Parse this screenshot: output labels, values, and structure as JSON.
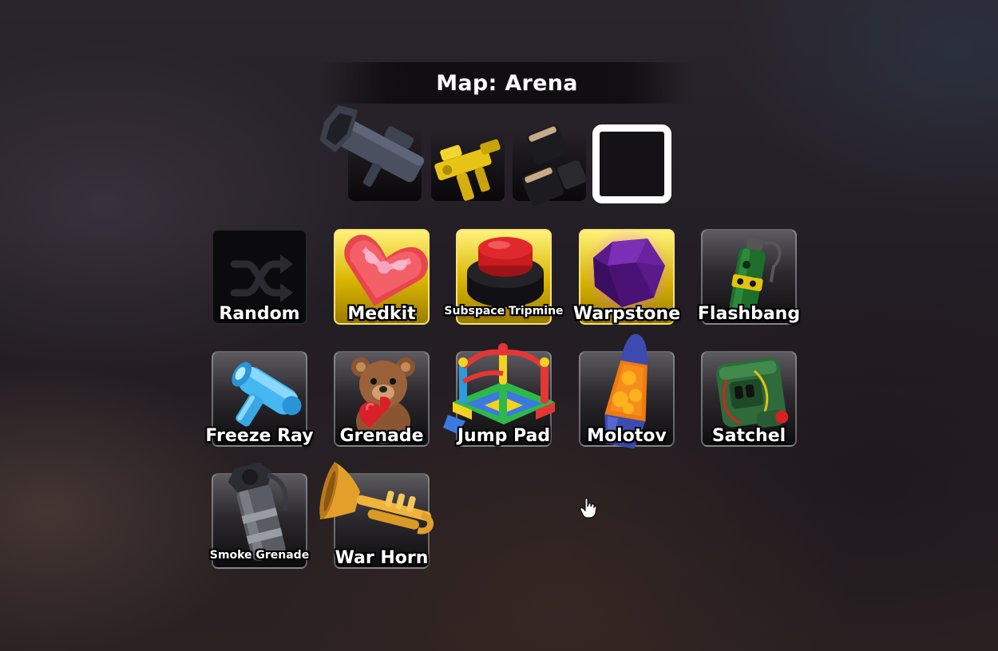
{
  "header": {
    "title": "Map: Arena"
  },
  "loadout": {
    "slots": [
      {
        "name": "rocket-launcher-icon"
      },
      {
        "name": "gold-gun-icon"
      },
      {
        "name": "dark-blocks-icon"
      },
      {
        "name": "empty-slot"
      }
    ]
  },
  "items": [
    {
      "label": "Random",
      "icon": "shuffle-icon",
      "rarity": "none"
    },
    {
      "label": "Medkit",
      "icon": "heart-box-icon",
      "rarity": "gold"
    },
    {
      "label": "Subspace Tripmine",
      "icon": "red-button-icon",
      "rarity": "gold"
    },
    {
      "label": "Warpstone",
      "icon": "purple-crystal-icon",
      "rarity": "gold"
    },
    {
      "label": "Flashbang",
      "icon": "flashbang-grenade-icon",
      "rarity": "normal"
    },
    {
      "label": "Freeze Ray",
      "icon": "freeze-ray-gun-icon",
      "rarity": "normal"
    },
    {
      "label": "Grenade",
      "icon": "teddy-bear-icon",
      "rarity": "normal"
    },
    {
      "label": "Jump Pad",
      "icon": "bounce-house-icon",
      "rarity": "normal"
    },
    {
      "label": "Molotov",
      "icon": "lava-lamp-icon",
      "rarity": "normal"
    },
    {
      "label": "Satchel",
      "icon": "satchel-pack-icon",
      "rarity": "normal"
    },
    {
      "label": "Smoke Grenade",
      "icon": "smoke-canister-icon",
      "rarity": "normal"
    },
    {
      "label": "War Horn",
      "icon": "trumpet-icon",
      "rarity": "normal"
    }
  ],
  "colors": {
    "gold_tile": "#d8b400",
    "title_text": "#ffffff"
  }
}
